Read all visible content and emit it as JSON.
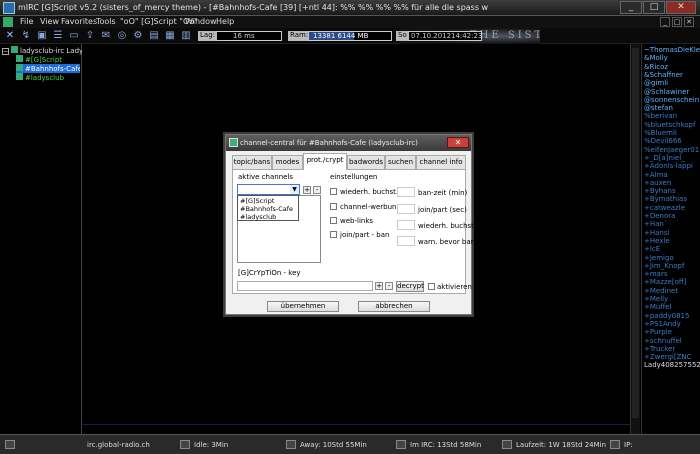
{
  "window": {
    "title": "mIRC [G]Script v5.2 (sisters_of_mercy theme) - [#Bahnhofs-Cafe [39] [+ntl 44]: %% %% %% %% für alle die spass wollen bitte nicht ungefragt pm ansonsten]",
    "minimize": "_",
    "maximize": "□",
    "close": "✕"
  },
  "menu": {
    "items": [
      "File",
      "View",
      "Favorites",
      "Tools",
      "\"oO\" [G]Script \"Oo\"",
      "Window",
      "Help"
    ],
    "mdi_controls": [
      "_",
      "□",
      "✕"
    ]
  },
  "toolbar": {
    "lag_label": "Lag:",
    "lag_value": "16 ms",
    "ram_label": "Ram:",
    "ram_used_fraction": 0.55,
    "ram_value": "13381 6144 MB",
    "date_label": "So",
    "date_value": "07.10.2012",
    "time_value": "14:42:23",
    "banner": "THE SISTERS OF MERCY"
  },
  "tree": {
    "server": "ladysclub-irc Lady",
    "channels": [
      "#[G]Script",
      "#Bahnhofs-Cafe",
      "#ladysclub"
    ],
    "selected_index": 1
  },
  "nicklist": [
    {
      "nick": "~ThomasDieKle",
      "color": "#5fb3ff"
    },
    {
      "nick": "&Molly",
      "color": "#5fb3ff"
    },
    {
      "nick": "&Ricoz",
      "color": "#5fb3ff"
    },
    {
      "nick": "&Schaffner",
      "color": "#5fb3ff"
    },
    {
      "nick": "@gimli",
      "color": "#5fb3ff"
    },
    {
      "nick": "@Schlawiner",
      "color": "#5fb3ff"
    },
    {
      "nick": "@sonnenschein",
      "color": "#5fb3ff"
    },
    {
      "nick": "@stefan",
      "color": "#5fb3ff"
    },
    {
      "nick": "%berivan",
      "color": "#3a7cc9"
    },
    {
      "nick": "%bluetschkopf",
      "color": "#3a7cc9"
    },
    {
      "nick": "%Bluemli",
      "color": "#3a7cc9"
    },
    {
      "nick": "%Devil666",
      "color": "#3a7cc9"
    },
    {
      "nick": "%elfenjaeger01",
      "color": "#3a7cc9"
    },
    {
      "nick": "+_D[a]niel_",
      "color": "#3a7cc9"
    },
    {
      "nick": "+Adonis-lappi",
      "color": "#3a7cc9"
    },
    {
      "nick": "+Alma",
      "color": "#3a7cc9"
    },
    {
      "nick": "+auxen",
      "color": "#3a7cc9"
    },
    {
      "nick": "+Byhans",
      "color": "#3a7cc9"
    },
    {
      "nick": "+Bymathias",
      "color": "#3a7cc9"
    },
    {
      "nick": "+catweazle",
      "color": "#3a7cc9"
    },
    {
      "nick": "+Denora",
      "color": "#3a7cc9"
    },
    {
      "nick": "+Han`",
      "color": "#3a7cc9"
    },
    {
      "nick": "+Hansi",
      "color": "#3a7cc9"
    },
    {
      "nick": "+Hexle",
      "color": "#3a7cc9"
    },
    {
      "nick": "+IcE",
      "color": "#3a7cc9"
    },
    {
      "nick": "+Jemigo",
      "color": "#3a7cc9"
    },
    {
      "nick": "+Jim_Knopf",
      "color": "#3a7cc9"
    },
    {
      "nick": "+mars",
      "color": "#3a7cc9"
    },
    {
      "nick": "+Mazze[off]",
      "color": "#3a7cc9"
    },
    {
      "nick": "+Medinet",
      "color": "#3a7cc9"
    },
    {
      "nick": "+Melly",
      "color": "#3a7cc9"
    },
    {
      "nick": "+Muffel",
      "color": "#3a7cc9"
    },
    {
      "nick": "+paddy0815",
      "color": "#3a7cc9"
    },
    {
      "nick": "+PS1Andy",
      "color": "#3a7cc9"
    },
    {
      "nick": "+Purple",
      "color": "#3a7cc9"
    },
    {
      "nick": "+schnuffel",
      "color": "#3a7cc9"
    },
    {
      "nick": "+Trucker",
      "color": "#3a7cc9"
    },
    {
      "nick": "+Zwergi[ZNC",
      "color": "#3a7cc9"
    },
    {
      "nick": "Lady408257552",
      "color": "#dddddd"
    }
  ],
  "statusbar": {
    "server": "irc.global-radio.ch",
    "idle": "Idle: 3Min",
    "away": "Away: 10Std 55Min",
    "in_irc": "Im IRC: 13Std 58Min",
    "uptime": "Laufzeit: 1W 18Std 24Min",
    "ip": "IP:"
  },
  "dialog": {
    "title": "channel-central für #Bahnhofs-Cafe (ladysclub-irc)",
    "tabs": [
      "topic/bans",
      "modes",
      "prot./crypt",
      "badwords",
      "suchen",
      "channel info"
    ],
    "active_tab_index": 2,
    "active_channels_label": "aktive channels",
    "channel_options": [
      "#[G]Script",
      "#Bahnhofs-Cafe",
      "#ladysclub"
    ],
    "add_btn": "+",
    "remove_btn": "-",
    "settings_label": "einstellungen",
    "checkboxes": [
      "wiederh. buchst.",
      "channel-werbung",
      "web-links",
      "join/part - ban"
    ],
    "fields": [
      "ban-zeit (min)",
      "join/part (sec)",
      "wiederh. buchst.",
      "warn. bevor ban"
    ],
    "crypt_label": "[G]CrYpTiOn - key",
    "key_add": "+",
    "key_remove": "-",
    "decrypt_btn": "decrypt",
    "activate_label": "aktivieren",
    "ok_btn": "übernehmen",
    "cancel_btn": "abbrechen"
  }
}
